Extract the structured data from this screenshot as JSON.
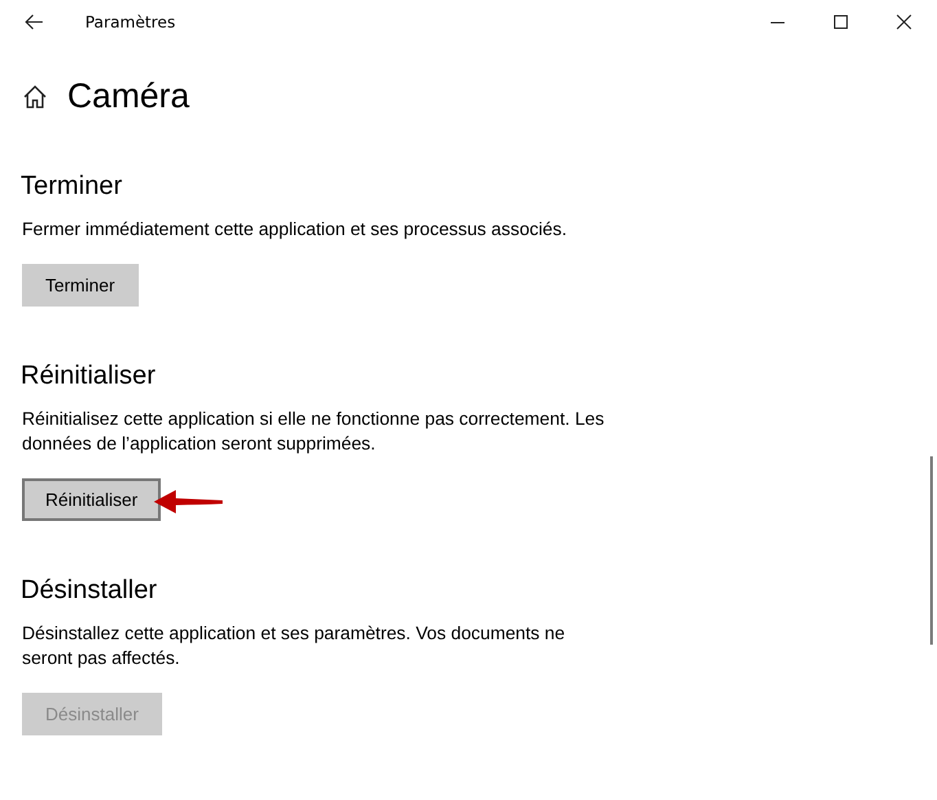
{
  "window": {
    "title": "Paramètres"
  },
  "page": {
    "title": "Caméra"
  },
  "sections": [
    {
      "title": "Terminer",
      "description": "Fermer immédiatement cette application et ses processus associés.",
      "button": {
        "label": "Terminer",
        "disabled": false,
        "focused": false,
        "annotated": false
      }
    },
    {
      "title": "Réinitialiser",
      "description": "Réinitialisez cette application si elle ne fonctionne pas correctement. Les données de l’application seront supprimées.",
      "button": {
        "label": "Réinitialiser",
        "disabled": false,
        "focused": true,
        "annotated": true
      }
    },
    {
      "title": "Désinstaller",
      "description": "Désinstallez cette application et ses paramètres. Vos documents ne seront pas affectés.",
      "button": {
        "label": "Désinstaller",
        "disabled": true,
        "focused": false,
        "annotated": false
      }
    }
  ]
}
